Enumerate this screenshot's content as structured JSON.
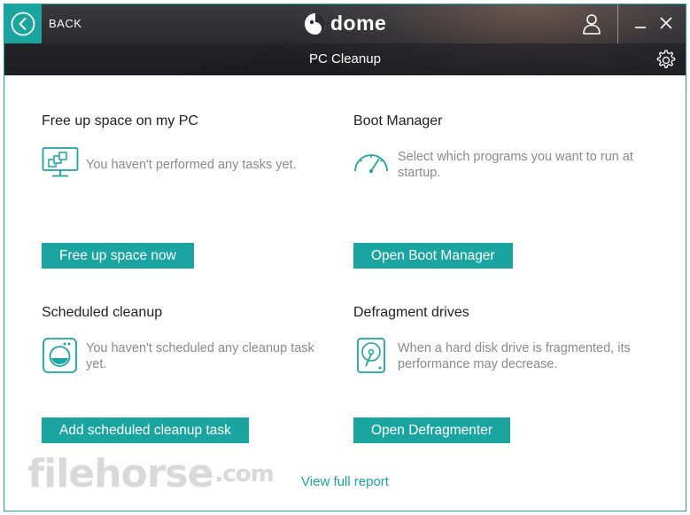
{
  "header": {
    "back_label": "BACK",
    "logo_text": "dome",
    "subtitle": "PC Cleanup"
  },
  "cards": {
    "free_space": {
      "title": "Free up space on my PC",
      "desc": "You haven't performed any tasks yet.",
      "button": "Free up space now"
    },
    "boot_manager": {
      "title": "Boot Manager",
      "desc": "Select which programs you want to run at startup.",
      "button": "Open Boot Manager"
    },
    "scheduled": {
      "title": "Scheduled cleanup",
      "desc": "You haven't scheduled any cleanup task yet.",
      "button": "Add scheduled cleanup task"
    },
    "defrag": {
      "title": "Defragment drives",
      "desc": "When a hard disk drive is fragmented, its performance may decrease.",
      "button": "Open Defragmenter"
    }
  },
  "footer": {
    "report_link": "View full report"
  },
  "watermark": {
    "text": "filehorse",
    "suffix": ".com"
  },
  "colors": {
    "accent": "#1aa5a0"
  }
}
